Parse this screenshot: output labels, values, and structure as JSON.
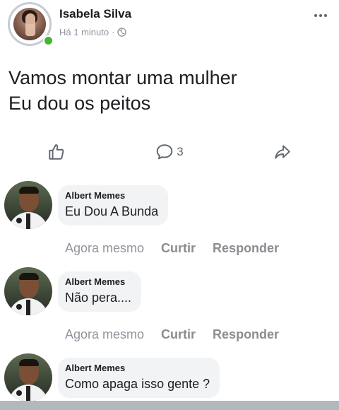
{
  "post": {
    "author": "Isabela Silva",
    "time": "Há 1 minuto",
    "separator": "·",
    "text_lines": [
      "Vamos montar uma mulher",
      "Eu dou os peitos"
    ],
    "comment_count": "3",
    "icons": {
      "privacy": "globe-icon",
      "like": "thumbs-up-icon",
      "comment": "comment-bubble-icon",
      "share": "share-arrow-icon",
      "menu": "more-dots-icon"
    },
    "online_status_color": "#42b72a"
  },
  "comments": [
    {
      "author": "Albert Memes",
      "text": "Eu Dou A Bunda",
      "time": "Agora mesmo",
      "like_label": "Curtir",
      "reply_label": "Responder"
    },
    {
      "author": "Albert Memes",
      "text": "Não pera....",
      "time": "Agora mesmo",
      "like_label": "Curtir",
      "reply_label": "Responder"
    },
    {
      "author": "Albert Memes",
      "text": "Como apaga isso gente ?"
    }
  ],
  "colors": {
    "text": "#1c1e21",
    "secondary_text": "#8d949e",
    "bubble_background": "#f2f3f5",
    "icon": "#606770"
  }
}
